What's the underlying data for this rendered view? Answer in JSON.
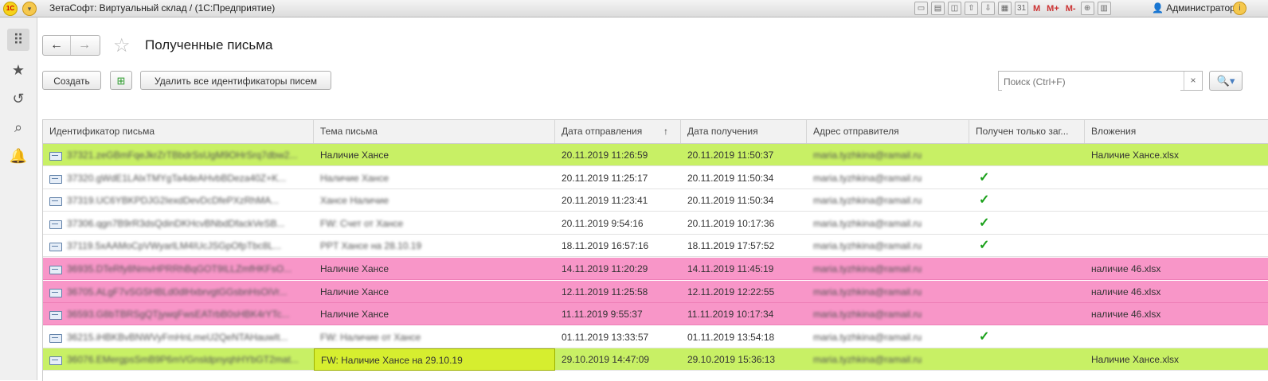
{
  "titlebar": {
    "logo": "1С",
    "title": "ЗетаСофт: Виртуальный склад /  (1С:Предприятие)",
    "m_buttons": [
      "M",
      "M+",
      "M-"
    ],
    "user": "Администратор",
    "icons": [
      "save-icon",
      "print-icon",
      "preview-icon",
      "upload-icon",
      "download-icon",
      "calculator-icon",
      "calendar-icon",
      "zoom-icon",
      "panel-icon"
    ]
  },
  "sidebar": {
    "items": [
      "apps-menu-icon",
      "star-icon",
      "history-icon",
      "search-icon",
      "bell-icon"
    ]
  },
  "page": {
    "title": "Полученные письма",
    "back": "←",
    "forward": "→",
    "star": "☆"
  },
  "toolbar": {
    "create_label": "Создать",
    "delete_ids_label": "Удалить все идентификаторы писем"
  },
  "search": {
    "placeholder": "Поиск (Ctrl+F)",
    "clear": "×",
    "icon": "🔍▾"
  },
  "table": {
    "columns": [
      "Идентификатор письма",
      "Тема письма",
      "Дата отправления",
      "Дата получения",
      "Адрес отправителя",
      "Получен только заг...",
      "Вложения"
    ],
    "sort_indicator": "↑",
    "rows": [
      {
        "id": "37321.zeGBmFqeJkrZrTBbdrSsUgM9OHrSrq7dbw2...",
        "subject": "Наличие Хансе",
        "sent": "20.11.2019 11:26:59",
        "received": "20.11.2019 11:50:37",
        "sender": "maria.tyzhkina@ramail.ru",
        "headers_only": "",
        "attachments": "Наличие Хансе.xlsx",
        "style": "green"
      },
      {
        "id": "37320.gWdE1LAlxTMYgTa4deAHvbBDeza40Z+K...",
        "subject": "Наличие Хансе",
        "sent": "20.11.2019 11:25:17",
        "received": "20.11.2019 11:50:34",
        "sender": "maria.tyzhkina@ramail.ru",
        "headers_only": "✓",
        "attachments": "",
        "style": "plain"
      },
      {
        "id": "37319.UC6YBKPDJG2IexdDevDcDfePXzRhMA...",
        "subject": "Хансе Наличие",
        "sent": "20.11.2019 11:23:41",
        "received": "20.11.2019 11:50:34",
        "sender": "maria.tyzhkina@ramail.ru",
        "headers_only": "✓",
        "attachments": "",
        "style": "plain"
      },
      {
        "id": "37306.qgn7B9rR3dsQdinDKHcvBNbdDfackVeSB...",
        "subject": "FW: Счет от Хансе",
        "sent": "20.11.2019 9:54:16",
        "received": "20.11.2019 10:17:36",
        "sender": "maria.tyzhkina@ramail.ru",
        "headers_only": "✓",
        "attachments": "",
        "style": "plain"
      },
      {
        "id": "37119.5xAAMoCpVWyarlLM4IUcJSGpOfpTbc8L...",
        "subject": "PPT Хансе на 28.10.19",
        "sent": "18.11.2019 16:57:16",
        "received": "18.11.2019 17:57:52",
        "sender": "maria.tyzhkina@ramail.ru",
        "headers_only": "✓",
        "attachments": "",
        "style": "plain"
      },
      {
        "id": "36935.DTeRfy8NmvHPRRhBqGOT9ILLZmfHKFsO...",
        "subject": "Наличие Хансе",
        "sent": "14.11.2019 11:20:29",
        "received": "14.11.2019 11:45:19",
        "sender": "maria.tyzhkina@ramail.ru",
        "headers_only": "",
        "attachments": "наличие 46.xlsx",
        "style": "pink"
      },
      {
        "id": "36705.ALgF7vSGSHBLd0dlHxbrvgtGGsbnHsOiVr...",
        "subject": "Наличие Хансе",
        "sent": "12.11.2019 11:25:58",
        "received": "12.11.2019 12:22:55",
        "sender": "maria.tyzhkina@ramail.ru",
        "headers_only": "",
        "attachments": "наличие 46.xlsx",
        "style": "pink"
      },
      {
        "id": "36593.G8bTBRSgQTjywqFwsEATrbB0sHBK4rYTc...",
        "subject": "Наличие Хансе",
        "sent": "11.11.2019 9:55:37",
        "received": "11.11.2019 10:17:34",
        "sender": "maria.tyzhkina@ramail.ru",
        "headers_only": "",
        "attachments": "наличие 46.xlsx",
        "style": "pink"
      },
      {
        "id": "36215.iHBKBvBNWVyFmHnLmeU2QeNTAHauwIt...",
        "subject": "FW: Наличие от Хансе",
        "sent": "01.11.2019 13:33:57",
        "received": "01.11.2019 13:54:18",
        "sender": "maria.tyzhkina@ramail.ru",
        "headers_only": "✓",
        "attachments": "",
        "style": "plain"
      },
      {
        "id": "36076.EMergpsSmB9P6mVGnsldpnyqhHYbGT2mat...",
        "subject": "FW: Наличие Хансе на 29.10.19",
        "sent": "29.10.2019 14:47:09",
        "received": "29.10.2019 15:36:13",
        "sender": "maria.tyzhkina@ramail.ru",
        "headers_only": "",
        "attachments": "Наличие Хансе.xlsx",
        "style": "green"
      }
    ]
  },
  "colors": {
    "green_row": "#c8f065",
    "pink_row": "#f896c8",
    "check": "#19a019"
  }
}
